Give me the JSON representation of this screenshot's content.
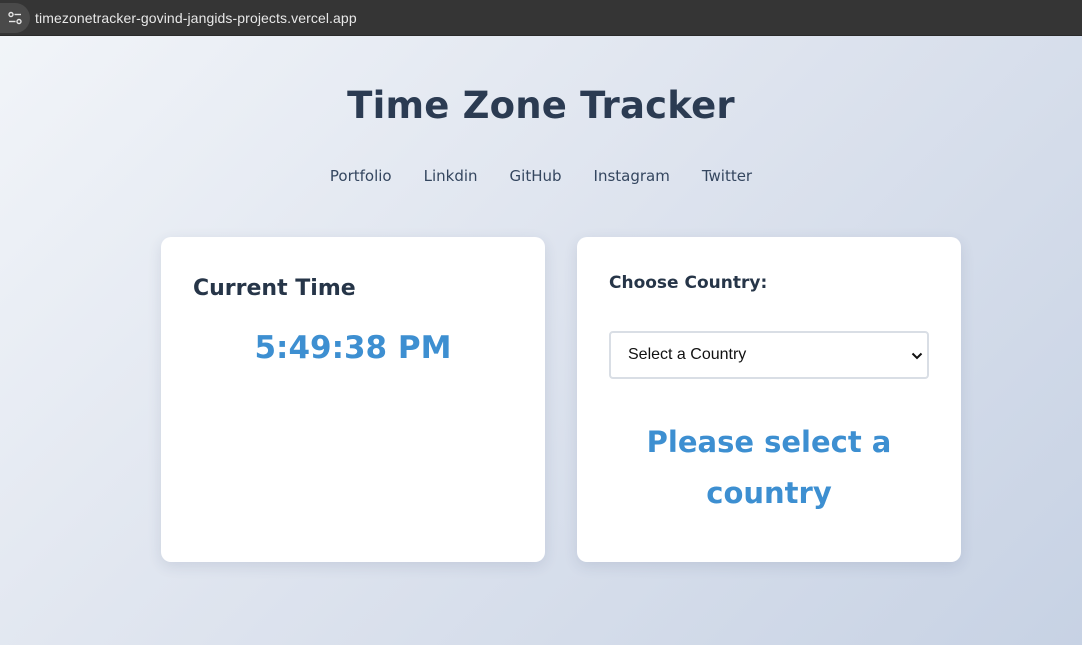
{
  "browser": {
    "url": "timezonetracker-govind-jangids-projects.vercel.app",
    "site_info_icon": "tune-icon"
  },
  "page": {
    "title": "Time Zone Tracker"
  },
  "nav": {
    "items": [
      {
        "label": "Portfolio"
      },
      {
        "label": "Linkdin"
      },
      {
        "label": "GitHub"
      },
      {
        "label": "Instagram"
      },
      {
        "label": "Twitter"
      }
    ]
  },
  "current_time_card": {
    "heading": "Current Time",
    "time": "5:49:38 PM"
  },
  "country_card": {
    "heading": "Choose Country:",
    "select_value": "Select a Country",
    "message": "Please select a country"
  },
  "colors": {
    "accent": "#3d8fd1",
    "heading": "#2b3b52",
    "address_bar": "#353535"
  }
}
